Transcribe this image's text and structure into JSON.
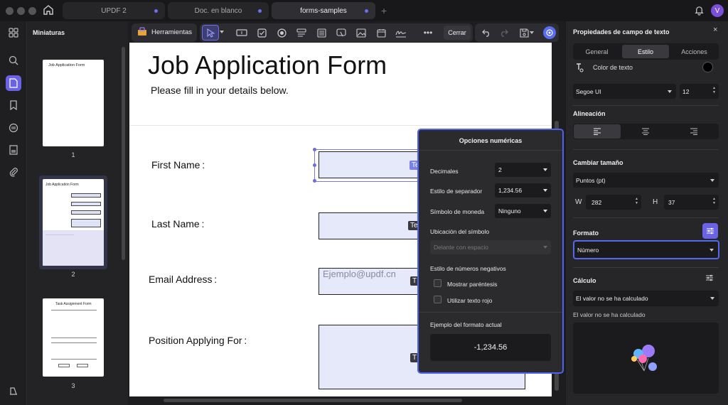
{
  "tabs": [
    {
      "label": "UPDF 2"
    },
    {
      "label": "Doc. en blanco"
    },
    {
      "label": "forms-samples"
    }
  ],
  "user": {
    "avatar": "V"
  },
  "thumbs": {
    "title": "Miniaturas",
    "pages": [
      {
        "num": "1",
        "title": "Job Application Form"
      },
      {
        "num": "2",
        "title": "Job Application Form"
      },
      {
        "num": "3",
        "title": "Task Assignment Form"
      }
    ]
  },
  "toolbar": {
    "tools_label": "Herramientas",
    "close_label": "Cerrar"
  },
  "doc": {
    "title": "Job Application Form",
    "subtitle": "Please fill in your details below.",
    "first_name": "First Name :",
    "last_name": "Last Name :",
    "email": "Email Address :",
    "email_placeholder": "Ejemplo@updf.cn",
    "position": "Position Applying For :",
    "field_tag": "Te",
    "field_tag_short": "T"
  },
  "popup": {
    "title": "Opciones numéricas",
    "decimals_label": "Decimales",
    "decimals": "2",
    "separator_label": "Estilo de separador",
    "separator": "1,234.56",
    "currency_label": "Símbolo de moneda",
    "currency": "Ninguno",
    "symbol_pos_label": "Ubicación del símbolo",
    "symbol_pos": "Delante con espacio",
    "neg_label": "Estilo de números negativos",
    "paren_label": "Mostrar paréntesis",
    "red_label": "Utilizar texto rojo",
    "example_label": "Ejemplo del formato actual",
    "example": "-1,234.56"
  },
  "panel": {
    "title": "Propiedades de campo de texto",
    "tabs": [
      "General",
      "Estilo",
      "Acciones"
    ],
    "text_color_label": "Color de texto",
    "font": "Segoe UI",
    "font_size": "12",
    "align_label": "Alineación",
    "resize_label": "Cambiar tamaño",
    "units": "Puntos (pt)",
    "w_label": "W",
    "w": "282",
    "h_label": "H",
    "h": "37",
    "format_label": "Formato",
    "format": "Número",
    "calc_label": "Cálculo",
    "calc_value": "El valor no se ha calculado",
    "calc_note": "El valor no se ha calculado"
  },
  "colors": {
    "accent": "#5468f0",
    "field": "#e5e9fa",
    "text_color": "#000000"
  }
}
